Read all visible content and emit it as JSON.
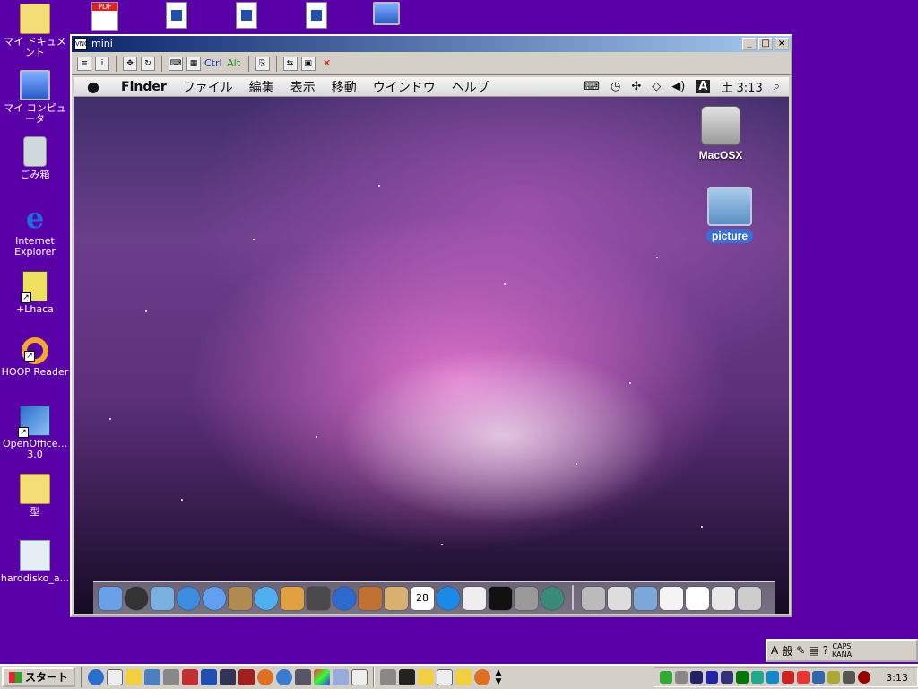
{
  "desktop": {
    "icons": [
      {
        "label": "マイ ドキュメント",
        "icon": "folder-icon"
      },
      {
        "label": "マイ コンピュータ",
        "icon": "computer-icon"
      },
      {
        "label": "ごみ箱",
        "icon": "recycle-bin-icon"
      },
      {
        "label": "Internet Explorer",
        "icon": "internet-explorer-icon",
        "glyph": "e"
      },
      {
        "label": "+Lhaca",
        "icon": "lhaca-icon"
      },
      {
        "label": "HOOP Reader",
        "icon": "hoop-reader-icon"
      },
      {
        "label": "OpenOffice... 3.0",
        "icon": "openoffice-icon"
      },
      {
        "label": "型",
        "icon": "folder-icon"
      },
      {
        "label": "harddisko_a...",
        "icon": "hdd-image-icon"
      }
    ],
    "top_icons": [
      {
        "icon": "pdf-file-icon",
        "badge": "PDF"
      },
      {
        "icon": "document-file-icon"
      },
      {
        "icon": "document-file-icon"
      },
      {
        "icon": "document-file-icon"
      },
      {
        "icon": "network-icon"
      }
    ]
  },
  "window": {
    "title": "mini",
    "title_icon_text": "VNC",
    "controls": [
      "_",
      "□",
      "×"
    ],
    "toolbar": {
      "ctrl": "Ctrl",
      "alt": "Alt",
      "close": "✕"
    }
  },
  "mac": {
    "menu": [
      "Finder",
      "ファイル",
      "編集",
      "表示",
      "移動",
      "ウインドウ",
      "ヘルプ"
    ],
    "clock": "土 3:13",
    "input_indicator": "A",
    "desktop_icons": [
      {
        "label": "MacOSX",
        "icon": "hard-disk-icon"
      },
      {
        "label": "picture",
        "icon": "folder-icon",
        "selected": true
      }
    ],
    "calendar_day": "28"
  },
  "taskbar": {
    "start": "スタート",
    "clock": "3:13",
    "ime": {
      "mode": "A",
      "dict": "般",
      "caps": "CAPS",
      "kana": "KANA"
    }
  },
  "colors": {
    "desktop": "#5a00a8",
    "title_active": "#0a246a",
    "mac_selection": "#3b6fd6"
  }
}
